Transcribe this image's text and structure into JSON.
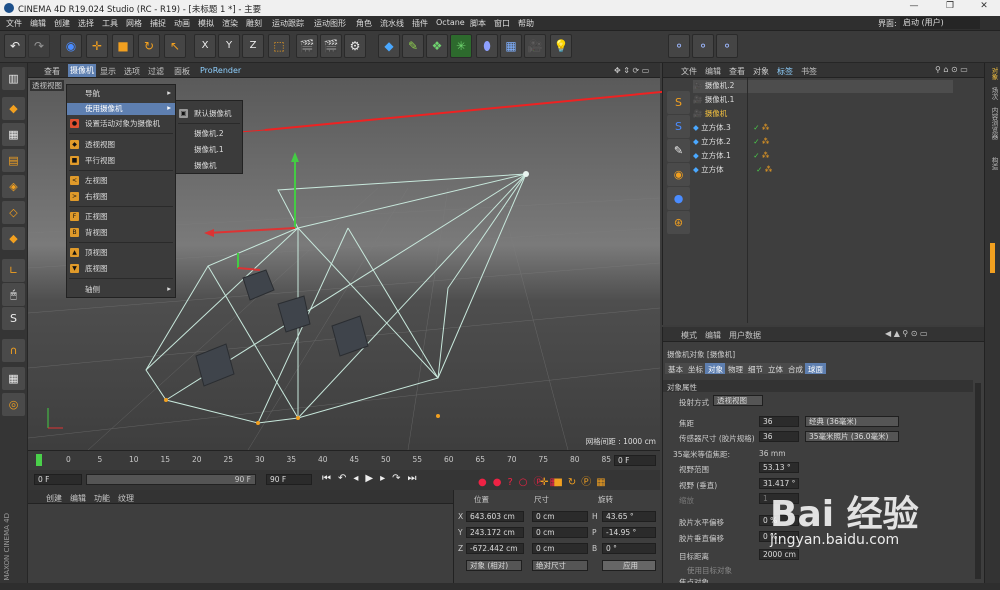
{
  "window": {
    "title": "CINEMA 4D R19.024 Studio (RC - R19) - [未标题 1 *] - 主要",
    "min": "—",
    "max": "❐",
    "close": "✕"
  },
  "menubar": [
    "文件",
    "编辑",
    "创建",
    "选择",
    "工具",
    "网格",
    "捕捉",
    "动画",
    "模拟",
    "渲染",
    "雕刻",
    "运动跟踪",
    "运动图形",
    "角色",
    "流水线",
    "插件",
    "Octane",
    "脚本",
    "窗口",
    "帮助"
  ],
  "layout": {
    "label": "界面:",
    "value": "启动 (用户)"
  },
  "viewport": {
    "menu": [
      "查看",
      "摄像机",
      "显示",
      "选项",
      "过滤",
      "面板",
      "ProRender"
    ],
    "view_label": "透视视图",
    "grid_spacing": "网格间距 : 1000 cm"
  },
  "camera_menu": {
    "items": [
      "导航",
      "使用摄像机",
      "设置活动对象为摄像机",
      "透视视图",
      "平行视图",
      "左视图",
      "右视图",
      "正视图",
      "背视图",
      "顶视图",
      "底视图",
      "轴侧"
    ],
    "submenu": [
      "默认摄像机",
      "摄像机.2",
      "摄像机.1",
      "摄像机"
    ]
  },
  "timeline": {
    "ticks": [
      "0",
      "5",
      "10",
      "15",
      "20",
      "25",
      "30",
      "35",
      "40",
      "45",
      "50",
      "55",
      "60",
      "65",
      "70",
      "75",
      "80",
      "85",
      "90"
    ],
    "current": "0 F"
  },
  "transport": {
    "start": "0 F",
    "slider_end": "90 F",
    "end": "90 F"
  },
  "material": {
    "menu": [
      "创建",
      "编辑",
      "功能",
      "纹理"
    ]
  },
  "coords": {
    "headers": [
      "位置",
      "尺寸",
      "旋转"
    ],
    "rows": [
      {
        "axis": "X",
        "pos": "643.603 cm",
        "size": "0 cm",
        "rl": "H",
        "rot": "43.65 °"
      },
      {
        "axis": "Y",
        "pos": "243.172 cm",
        "size": "0 cm",
        "rl": "P",
        "rot": "-14.95 °"
      },
      {
        "axis": "Z",
        "pos": "-672.442 cm",
        "size": "0 cm",
        "rl": "B",
        "rot": "0 °"
      }
    ],
    "mode": "对象 (相对)",
    "sizemode": "绝对尺寸",
    "apply": "应用"
  },
  "objects": {
    "menu": [
      "文件",
      "编辑",
      "查看",
      "对象",
      "标签",
      "书签"
    ],
    "items": [
      "摄像机.2",
      "摄像机.1",
      "摄像机",
      "立方体.3",
      "立方体.2",
      "立方体.1",
      "立方体"
    ]
  },
  "attributes": {
    "menu": [
      "模式",
      "编辑",
      "用户数据"
    ],
    "header": "摄像机对象 [摄像机]",
    "tabs": [
      "基本",
      "坐标",
      "对象",
      "物理",
      "细节",
      "立体",
      "合成",
      "球面"
    ],
    "section": "对象属性",
    "rows": [
      {
        "label": "投射方式",
        "value": "透视视图"
      },
      {
        "label": "焦距",
        "value": "36",
        "extra": "经典 (36毫米)"
      },
      {
        "label": "传感器尺寸 (胶片规格)",
        "value": "36",
        "extra": "35毫米照片 (36.0毫米)"
      },
      {
        "label": "35毫米等值焦距:",
        "value": "36 mm"
      },
      {
        "label": "视野范围",
        "value": "53.13 °"
      },
      {
        "label": "视野 (垂直)",
        "value": "31.417 °"
      },
      {
        "label": "缩放",
        "value": "1"
      },
      {
        "label": "胶片水平偏移",
        "value": "0 %"
      },
      {
        "label": "胶片垂直偏移",
        "value": "0 %"
      },
      {
        "label": "目标距离",
        "value": "2000 cm"
      },
      {
        "label": "使用目标对象",
        "value": ""
      },
      {
        "label": "焦点对象",
        "value": ""
      }
    ]
  },
  "right_tabs": [
    "对象",
    "场次",
    "内容浏览器",
    "构造"
  ],
  "left_brand": "MAXON CINEMA 4D",
  "watermark": {
    "logo": "Bai 经验",
    "url": "jingyan.baidu.com"
  }
}
